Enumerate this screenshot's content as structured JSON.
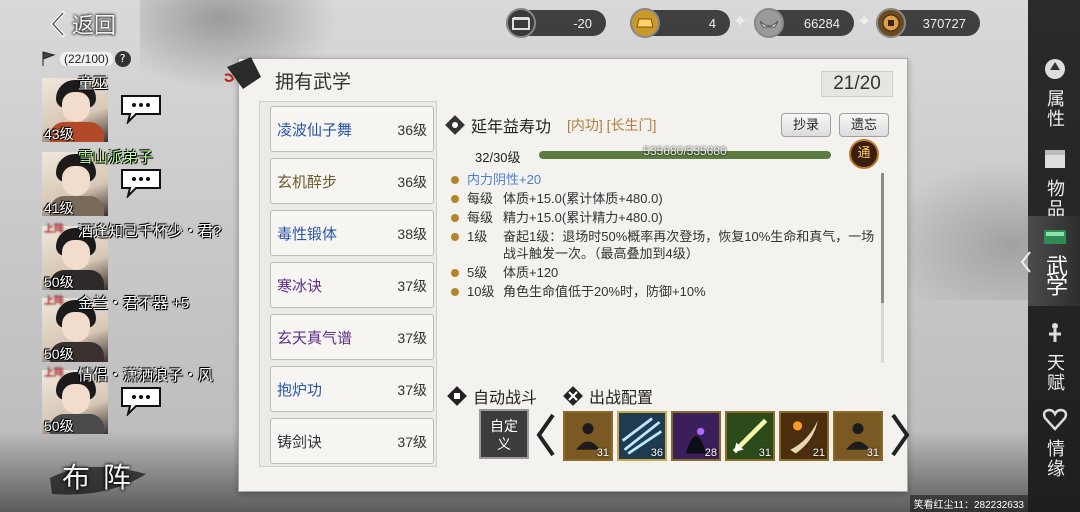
{
  "back": {
    "label": "返回"
  },
  "resources": [
    {
      "icon": "treasure-box-icon",
      "value": "-20",
      "has_plus": false
    },
    {
      "icon": "gold-bar-icon",
      "value": "4",
      "has_plus": true
    },
    {
      "icon": "silver-ingot-icon",
      "value": "66284",
      "has_plus": true
    },
    {
      "icon": "copper-coin-icon",
      "value": "370727",
      "has_plus": false
    }
  ],
  "roster": {
    "count": "(22/100)",
    "members": [
      {
        "name": "童巫",
        "level": "43级",
        "tag": "",
        "name_color": "white"
      },
      {
        "name": "雪山派弟子",
        "level": "41级",
        "tag": "",
        "name_color": "green"
      },
      {
        "name": "酒逢知己千杯少・君?",
        "level": "50级",
        "tag": "上阵",
        "name_color": "white"
      },
      {
        "name": "金兰・君不器 +5",
        "level": "50级",
        "tag": "上阵",
        "name_color": "white"
      },
      {
        "name": "情侣・潇洒浪子・风",
        "level": "50级",
        "tag": "上阵",
        "name_color": "white"
      }
    ],
    "formation_label": "布 阵"
  },
  "panel": {
    "title": "拥有武学",
    "count": "21/20",
    "skills": [
      {
        "name": "凌波仙子舞",
        "level": "36级",
        "color": "blue"
      },
      {
        "name": "玄机醉步",
        "level": "36级",
        "color": "olive"
      },
      {
        "name": "毒性锻体",
        "level": "38级",
        "color": "blue"
      },
      {
        "name": "寒冰诀",
        "level": "37级",
        "color": "purple"
      },
      {
        "name": "玄天真气谱",
        "level": "37级",
        "color": "purple"
      },
      {
        "name": "抱炉功",
        "level": "37级",
        "color": "blue"
      },
      {
        "name": "铸剑诀",
        "level": "37级",
        "color": "gray"
      }
    ],
    "detail": {
      "name": "延年益寿功",
      "type": "[内功] [长生门]",
      "copy_button": "抄录",
      "forget_button": "遗忘",
      "level_text": "32/30级",
      "exp_text": "535680/535680",
      "exp_fraction": 1.0,
      "tong_label": "通",
      "effects": [
        {
          "key": "",
          "value": "内力阴性+20",
          "highlight": true
        },
        {
          "key": "每级",
          "value": "体质+15.0(累计体质+480.0)"
        },
        {
          "key": "每级",
          "value": "精力+15.0(累计精力+480.0)"
        },
        {
          "key": "1级",
          "value": "奋起1级：退场时50%概率再次登场，恢复10%生命和真气，一场战斗触发一次。（最高叠加到4级）"
        },
        {
          "key": "5级",
          "value": "体质+120"
        },
        {
          "key": "10级",
          "value": "角色生命值低于20%时，防御+10%"
        }
      ],
      "auto_battle_label": "自动战斗",
      "battle_config_label": "出战配置",
      "custom_label": "自定义",
      "slots": [
        {
          "icon": "meditating-monk-icon",
          "count": "31"
        },
        {
          "icon": "ice-spikes-icon",
          "count": "36"
        },
        {
          "icon": "shadow-demon-icon",
          "count": "28"
        },
        {
          "icon": "sword-slash-icon",
          "count": "31"
        },
        {
          "icon": "blade-strike-icon",
          "count": "21"
        },
        {
          "icon": "meditating-monk-icon",
          "count": "31"
        }
      ]
    }
  },
  "nav": [
    {
      "label": "属性",
      "icon": "attributes-icon",
      "active": false
    },
    {
      "label": "物品",
      "icon": "items-box-icon",
      "active": false
    },
    {
      "label": "武学",
      "icon": "martial-book-icon",
      "active": true
    },
    {
      "label": "天赋",
      "icon": "talent-icon",
      "active": false
    },
    {
      "label": "情缘",
      "icon": "heart-icon",
      "active": false
    }
  ],
  "watermark": "笑看红尘11：282232633"
}
